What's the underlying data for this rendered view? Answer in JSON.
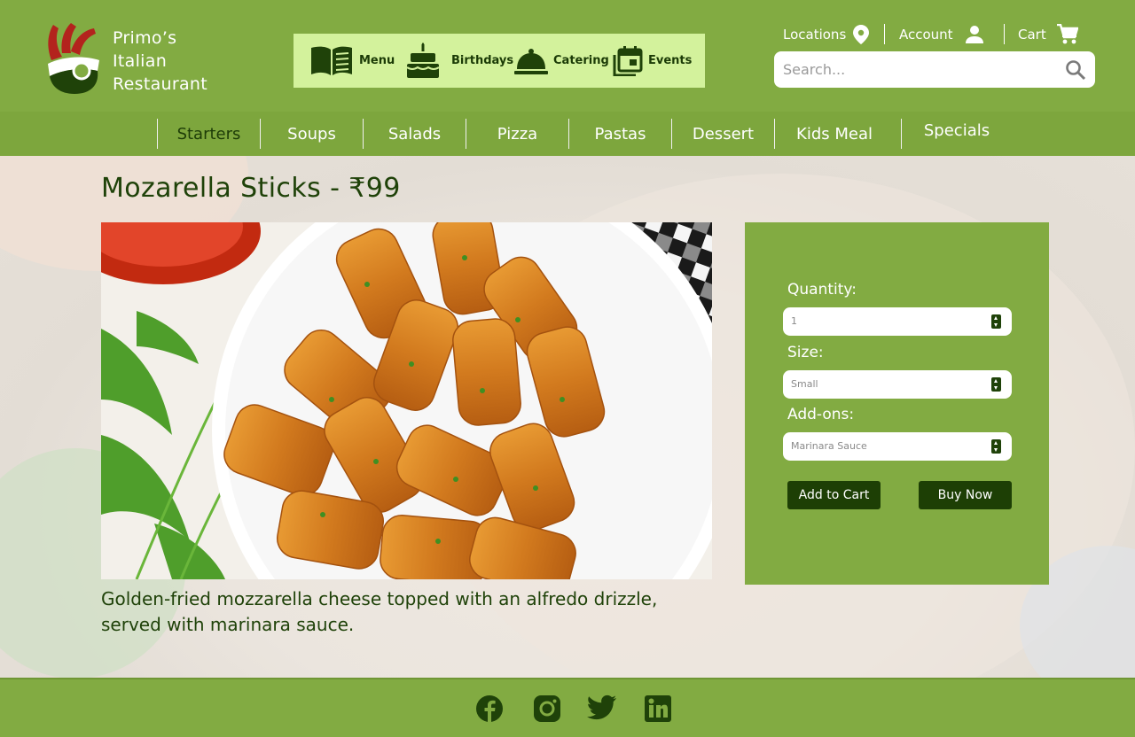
{
  "brand": {
    "line1": "Primo’s",
    "line2": "Italian",
    "line3": "Restaurant"
  },
  "quicknav": [
    {
      "label": "Menu",
      "icon": "menu-book-icon"
    },
    {
      "label": "Birthdays",
      "icon": "cake-icon"
    },
    {
      "label": "Catering",
      "icon": "cloche-icon"
    },
    {
      "label": "Events",
      "icon": "calendar-icon"
    }
  ],
  "toplinks": {
    "locations": "Locations",
    "account": "Account",
    "cart": "Cart"
  },
  "search": {
    "placeholder": "Search..."
  },
  "categories": [
    "Starters",
    "Soups",
    "Salads",
    "Pizza",
    "Pastas",
    "Dessert",
    "Kids Meal",
    "Specials"
  ],
  "active_category": "Starters",
  "product": {
    "title": "Mozarella Sticks - ₹99",
    "description": "Golden-fried mozzarella cheese topped with an alfredo drizzle, served with marinara sauce."
  },
  "order": {
    "quantity_label": "Quantity:",
    "quantity_value": "1",
    "size_label": "Size:",
    "size_value": "Small",
    "addons_label": "Add-ons:",
    "addons_value": "Marinara Sauce",
    "add_to_cart": "Add to Cart",
    "buy_now": "Buy Now"
  },
  "social": [
    "facebook-icon",
    "instagram-icon",
    "twitter-icon",
    "linkedin-icon"
  ],
  "colors": {
    "header_green": "#82ab42",
    "category_green": "#7da63d",
    "dark_green": "#1f4209",
    "quicknav_bg": "#d3f29c"
  }
}
